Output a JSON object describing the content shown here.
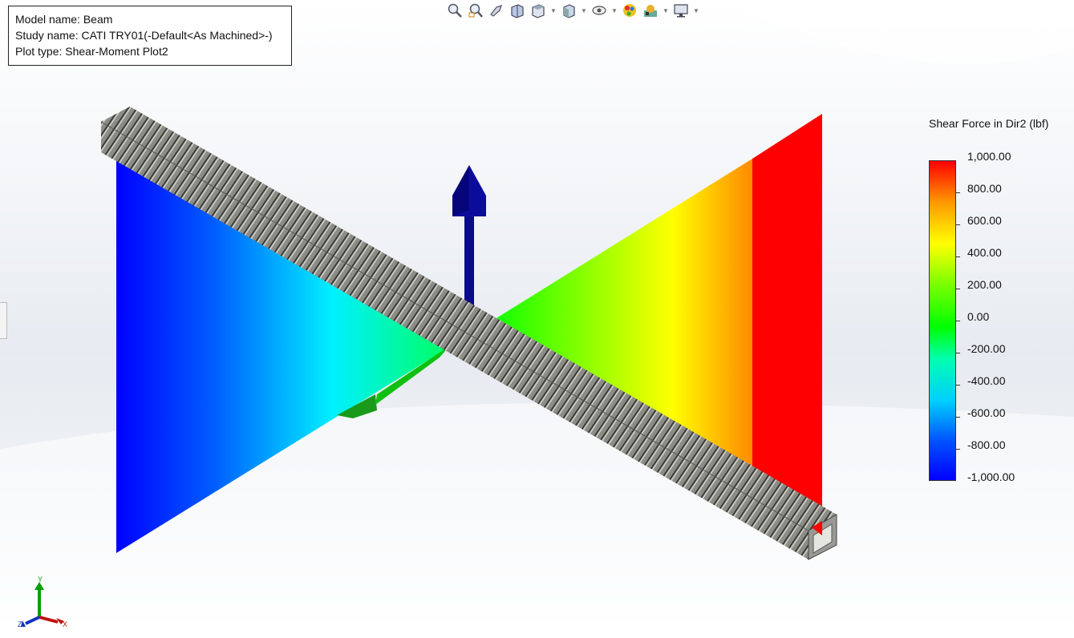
{
  "info": {
    "model_name": "Model name: Beam",
    "study_name": "Study name: CATI TRY01(-Default<As Machined>-)",
    "plot_type": "Plot type:  Shear-Moment Plot2"
  },
  "toolbar": {
    "items": [
      "zoom-to-fit-icon",
      "zoom-to-area-icon",
      "previous-view-icon",
      "section-view-icon",
      "view-orientation-icon",
      "display-style-icon",
      "hide-show-icon",
      "edit-appearance-icon",
      "apply-scene-icon",
      "view-settings-icon"
    ]
  },
  "legend": {
    "title": "Shear Force in Dir2 (lbf)",
    "labels": [
      "1,000.00",
      "800.00",
      "600.00",
      "400.00",
      "200.00",
      "0.00",
      "-200.00",
      "-400.00",
      "-600.00",
      "-800.00",
      "-1,000.00"
    ],
    "colors": [
      "#ff0000",
      "#ff9900",
      "#ffff00",
      "#80ff00",
      "#00ff00",
      "#00ffb0",
      "#00d0ff",
      "#0050ff",
      "#0000ff"
    ]
  },
  "triad": {
    "y": "Y",
    "z": "Z",
    "x": "X"
  }
}
